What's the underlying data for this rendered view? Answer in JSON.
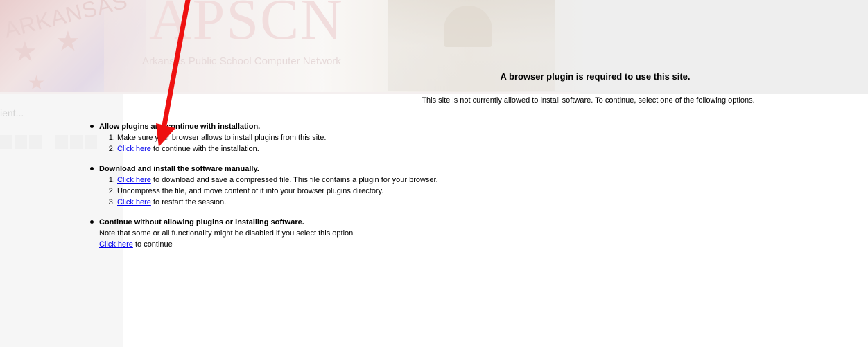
{
  "banner": {
    "logo_text": "APSCN",
    "logo_subtitle": "Arkansas Public School Computer Network",
    "flag_text": "ARKANSAS"
  },
  "sidebar": {
    "loading_text": "ient..."
  },
  "main": {
    "title": "A browser plugin is required to use this site.",
    "subtitle": "This site is not currently allowed to install software. To continue, select one of the following options.",
    "options": [
      {
        "heading": "Allow plugins and continue with installation.",
        "steps": [
          {
            "text": "Make sure your browser allows to install plugins from this site."
          },
          {
            "link": "Click here",
            "text": " to continue with the installation."
          }
        ]
      },
      {
        "heading": "Download and install the software manually.",
        "steps": [
          {
            "link": "Click here",
            "text": " to download and save a compressed file. This file contains a plugin for your browser."
          },
          {
            "text": "Uncompress the file, and move content of it into your browser plugins directory."
          },
          {
            "link": "Click here",
            "text": " to restart the session."
          }
        ]
      },
      {
        "heading": "Continue without allowing plugins or installing software.",
        "note": "Note that some or all functionality might be disabled if you select this option",
        "link": "Click here",
        "link_suffix": " to continue"
      }
    ]
  },
  "annotation": {
    "arrow_color": "#ee1111"
  },
  "colors": {
    "link": "#0000ee",
    "background": "#ffffff",
    "banner": "#eeeeee"
  }
}
